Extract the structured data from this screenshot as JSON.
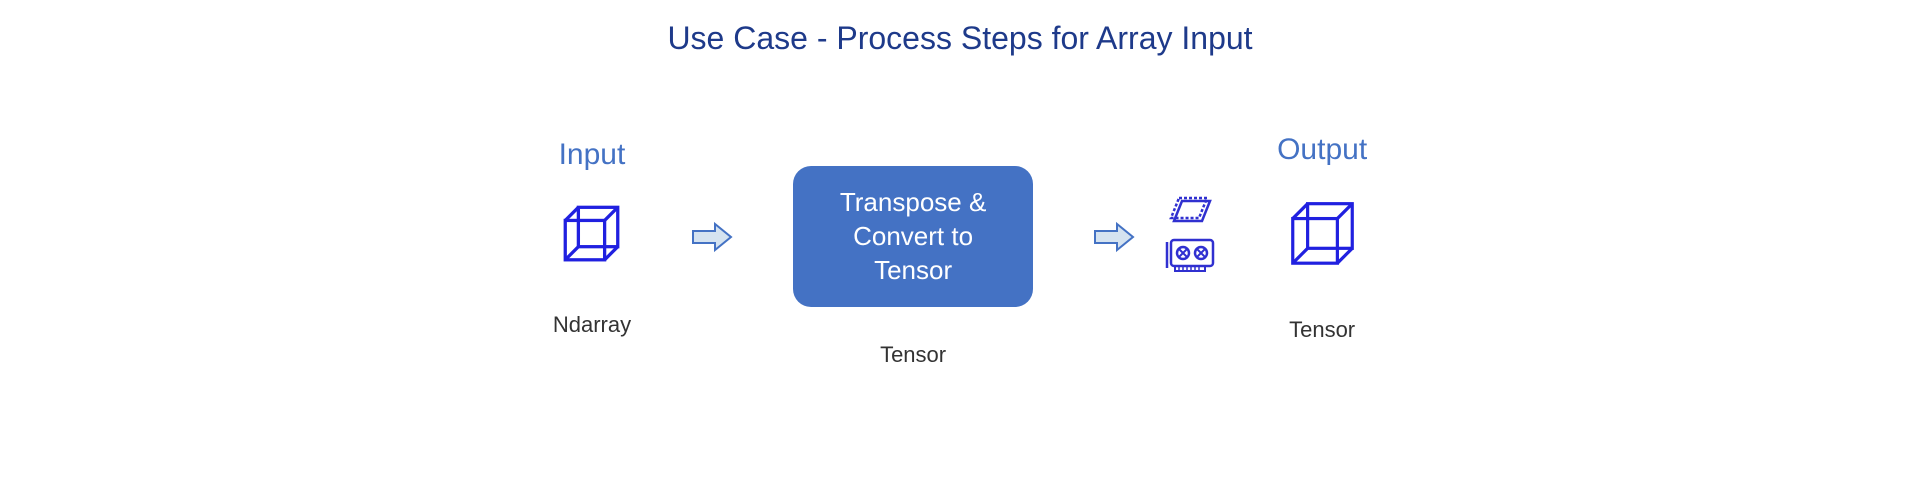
{
  "title": "Use Case - Process Steps for Array Input",
  "input": {
    "label": "Input",
    "caption": "Ndarray"
  },
  "process": {
    "label": "Transpose & Convert to Tensor",
    "caption": "Tensor"
  },
  "output": {
    "label": "Output",
    "caption": "Tensor"
  }
}
